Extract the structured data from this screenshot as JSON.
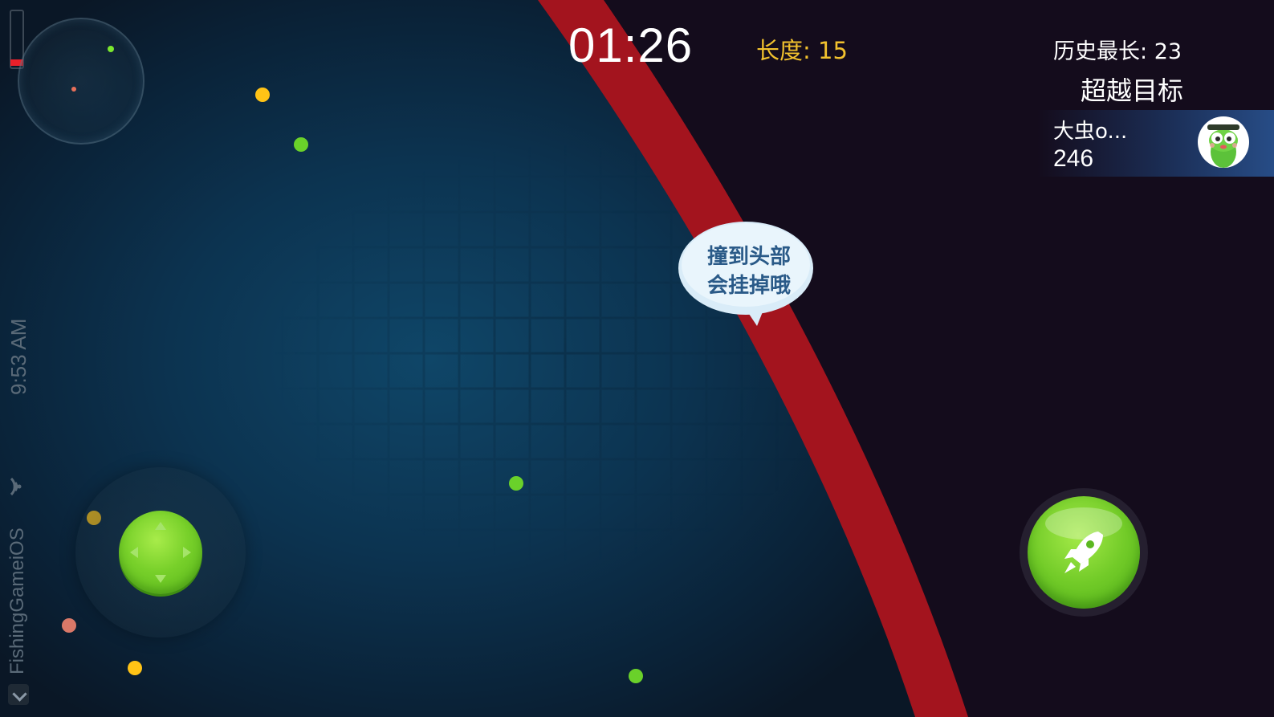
{
  "status_bar": {
    "time": "9:53 AM",
    "app_name": "FishingGameiOS",
    "battery_level": 0.12,
    "battery_color": "#e8202a"
  },
  "hud": {
    "timer": "01:26",
    "length_label": "长度:",
    "length_value": "15",
    "best_label": "历史最长:",
    "best_value": "23",
    "target_title": "超越目标"
  },
  "target": {
    "name": "大虫o...",
    "score": "246",
    "avatar_icon": "green-worm-avatar-icon"
  },
  "tip_bubble": {
    "line1": "撞到头部",
    "line2": "会挂掉哦"
  },
  "controls": {
    "joystick_icon": "dpad-joystick-icon",
    "boost_icon": "rocket-icon"
  },
  "colors": {
    "enemy_snake": "#a3141e",
    "length_text": "#f2c22e",
    "button_green": "#72cb28",
    "food_yellow": "#ffc316",
    "food_green": "#6ad12a",
    "food_red": "#d97868"
  }
}
